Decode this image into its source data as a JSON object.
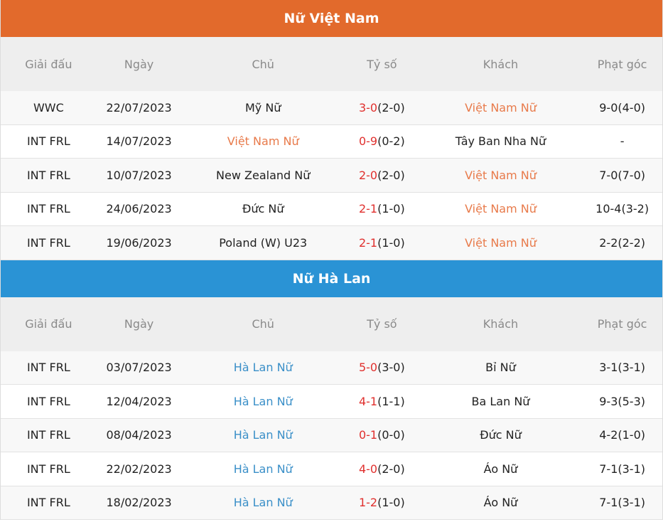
{
  "colors": {
    "vn_banner": "#e26a2c",
    "nl_banner": "#2a93d5",
    "vn_team": "#e87a4a",
    "nl_team": "#3a8fc8",
    "score_red": "#e0302e"
  },
  "columns": [
    "Giải đấu",
    "Ngày",
    "Chủ",
    "Tỷ số",
    "Khách",
    "Phạt góc"
  ],
  "vietnam": {
    "title": "Nữ Việt Nam",
    "rows": [
      {
        "league": "WWC",
        "date": "22/07/2023",
        "home": "Mỹ Nữ",
        "home_hl": false,
        "score": "3-0",
        "half": "(2-0)",
        "away": "Việt Nam Nữ",
        "away_hl": true,
        "corners": "9-0(4-0)"
      },
      {
        "league": "INT FRL",
        "date": "14/07/2023",
        "home": "Việt Nam Nữ",
        "home_hl": true,
        "score": "0-9",
        "half": "(0-2)",
        "away": "Tây Ban Nha Nữ",
        "away_hl": false,
        "corners": "-"
      },
      {
        "league": "INT FRL",
        "date": "10/07/2023",
        "home": "New Zealand Nữ",
        "home_hl": false,
        "score": "2-0",
        "half": "(2-0)",
        "away": "Việt Nam Nữ",
        "away_hl": true,
        "corners": "7-0(7-0)"
      },
      {
        "league": "INT FRL",
        "date": "24/06/2023",
        "home": "Đức Nữ",
        "home_hl": false,
        "score": "2-1",
        "half": "(1-0)",
        "away": "Việt Nam Nữ",
        "away_hl": true,
        "corners": "10-4(3-2)"
      },
      {
        "league": "INT FRL",
        "date": "19/06/2023",
        "home": "Poland (W) U23",
        "home_hl": false,
        "score": "2-1",
        "half": "(1-0)",
        "away": "Việt Nam Nữ",
        "away_hl": true,
        "corners": "2-2(2-2)"
      }
    ]
  },
  "netherlands": {
    "title": "Nữ Hà Lan",
    "rows": [
      {
        "league": "INT FRL",
        "date": "03/07/2023",
        "home": "Hà Lan Nữ",
        "home_hl": true,
        "score": "5-0",
        "half": "(3-0)",
        "away": "Bỉ Nữ",
        "away_hl": false,
        "corners": "3-1(3-1)"
      },
      {
        "league": "INT FRL",
        "date": "12/04/2023",
        "home": "Hà Lan Nữ",
        "home_hl": true,
        "score": "4-1",
        "half": "(1-1)",
        "away": "Ba Lan Nữ",
        "away_hl": false,
        "corners": "9-3(5-3)"
      },
      {
        "league": "INT FRL",
        "date": "08/04/2023",
        "home": "Hà Lan Nữ",
        "home_hl": true,
        "score": "0-1",
        "half": "(0-0)",
        "away": "Đức Nữ",
        "away_hl": false,
        "corners": "4-2(1-0)"
      },
      {
        "league": "INT FRL",
        "date": "22/02/2023",
        "home": "Hà Lan Nữ",
        "home_hl": true,
        "score": "4-0",
        "half": "(2-0)",
        "away": "Áo Nữ",
        "away_hl": false,
        "corners": "7-1(3-1)"
      },
      {
        "league": "INT FRL",
        "date": "18/02/2023",
        "home": "Hà Lan Nữ",
        "home_hl": true,
        "score": "1-2",
        "half": "(1-0)",
        "away": "Áo Nữ",
        "away_hl": false,
        "corners": "7-1(3-1)"
      }
    ]
  }
}
